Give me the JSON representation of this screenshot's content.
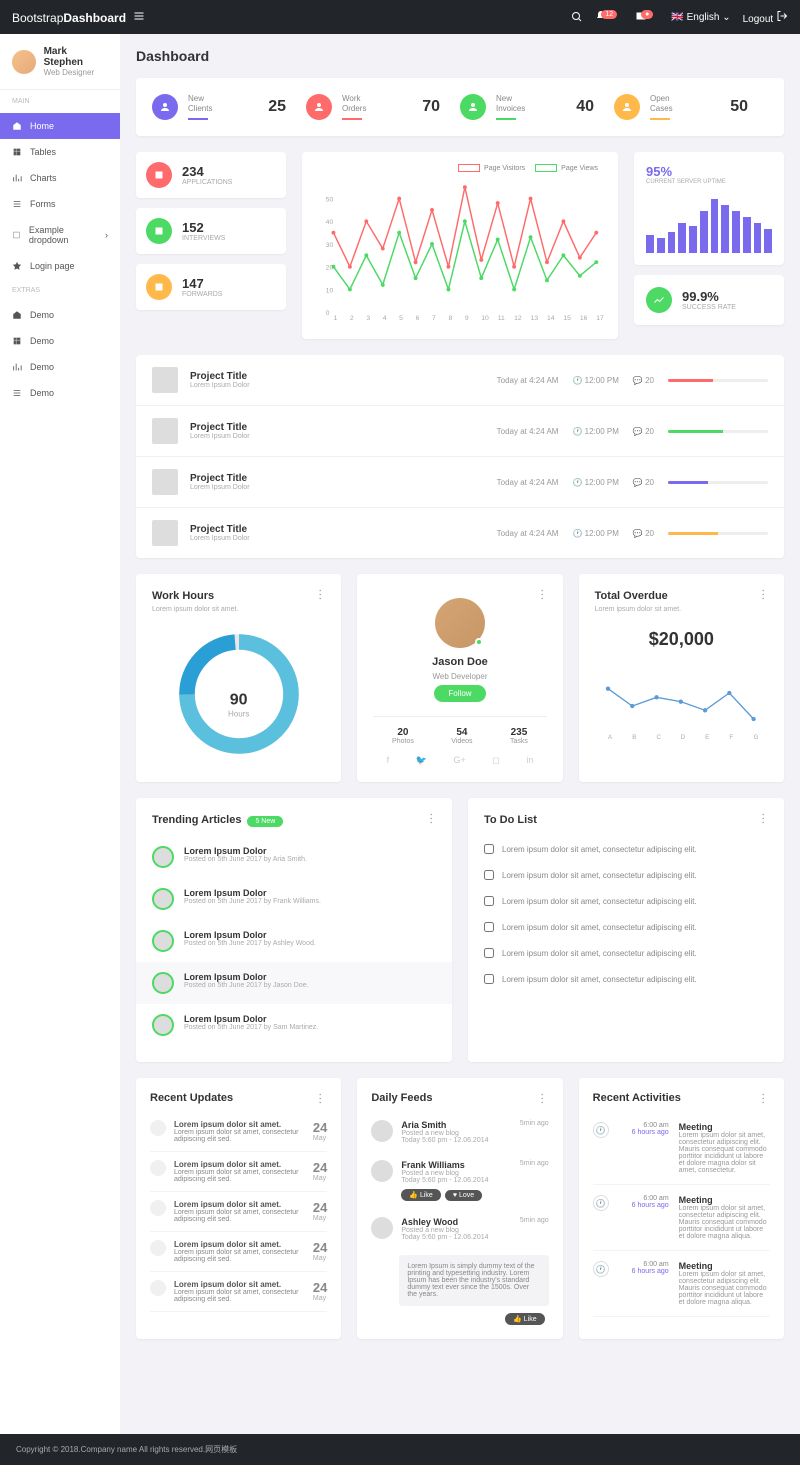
{
  "brand": {
    "a": "Bootstrap",
    "b": "Dashboard"
  },
  "topbar": {
    "lang": "English",
    "logout": "Logout",
    "notif_count": "12"
  },
  "user": {
    "name": "Mark Stephen",
    "role": "Web Designer"
  },
  "nav": {
    "sec1": "MAIN",
    "sec2": "EXTRAS",
    "items": [
      "Home",
      "Tables",
      "Charts",
      "Forms",
      "Example dropdown",
      "Login page"
    ],
    "extras": [
      "Demo",
      "Demo",
      "Demo",
      "Demo"
    ]
  },
  "page_title": "Dashboard",
  "stats": [
    {
      "label": "New Clients",
      "value": "25",
      "color": "#796aee"
    },
    {
      "label": "Work Orders",
      "value": "70",
      "color": "#ff6b6b"
    },
    {
      "label": "New Invoices",
      "value": "40",
      "color": "#4cd964"
    },
    {
      "label": "Open Cases",
      "value": "50",
      "color": "#ffb94a"
    }
  ],
  "minis": [
    {
      "value": "234",
      "label": "APPLICATIONS",
      "color": "#ff6b6b"
    },
    {
      "value": "152",
      "label": "INTERVIEWS",
      "color": "#4cd964"
    },
    {
      "value": "147",
      "label": "FORWARDS",
      "color": "#ffb94a"
    }
  ],
  "chart_data": {
    "type": "line",
    "x": [
      "1",
      "2",
      "3",
      "4",
      "5",
      "6",
      "7",
      "8",
      "9",
      "10",
      "11",
      "12",
      "13",
      "14",
      "15",
      "16",
      "17"
    ],
    "ylim": [
      0,
      60
    ],
    "yticks": [
      0,
      10,
      20,
      30,
      40,
      50
    ],
    "series": [
      {
        "name": "Page Visitors",
        "color": "#ff6b6b",
        "values": [
          35,
          20,
          40,
          28,
          50,
          22,
          45,
          20,
          55,
          23,
          48,
          20,
          50,
          22,
          40,
          24,
          35
        ]
      },
      {
        "name": "Page Views",
        "color": "#4cd964",
        "values": [
          20,
          10,
          25,
          12,
          35,
          15,
          30,
          10,
          40,
          15,
          32,
          10,
          33,
          14,
          25,
          16,
          22
        ]
      }
    ]
  },
  "uptime": {
    "value": "95%",
    "label": "CURRENT SERVER UPTIME",
    "bars": [
      30,
      25,
      35,
      50,
      45,
      70,
      90,
      80,
      70,
      60,
      50,
      40
    ]
  },
  "success": {
    "value": "99.9%",
    "label": "SUCCESS RATE"
  },
  "projects": [
    {
      "title": "Project Title",
      "sub": "Lorem Ipsum Dolor",
      "time": "Today at 4:24 AM",
      "clock": "12:00 PM",
      "comments": "20",
      "color": "#ff6b6b",
      "pct": 45
    },
    {
      "title": "Project Title",
      "sub": "Lorem Ipsum Dolor",
      "time": "Today at 4:24 AM",
      "clock": "12:00 PM",
      "comments": "20",
      "color": "#4cd964",
      "pct": 55
    },
    {
      "title": "Project Title",
      "sub": "Lorem Ipsum Dolor",
      "time": "Today at 4:24 AM",
      "clock": "12:00 PM",
      "comments": "20",
      "color": "#796aee",
      "pct": 40
    },
    {
      "title": "Project Title",
      "sub": "Lorem Ipsum Dolor",
      "time": "Today at 4:24 AM",
      "clock": "12:00 PM",
      "comments": "20",
      "color": "#ffb94a",
      "pct": 50
    }
  ],
  "workhours": {
    "title": "Work Hours",
    "sub": "Lorem ipsum dolor sit amet.",
    "value": "90",
    "unit": "Hours"
  },
  "usercard": {
    "name": "Jason Doe",
    "role": "Web Developer",
    "follow": "Follow",
    "stats": [
      {
        "v": "20",
        "l": "Photos"
      },
      {
        "v": "54",
        "l": "Videos"
      },
      {
        "v": "235",
        "l": "Tasks"
      }
    ]
  },
  "overdue": {
    "title": "Total Overdue",
    "sub": "Lorem ipsum dolor sit amet.",
    "value": "$20,000",
    "x": [
      "A",
      "B",
      "C",
      "D",
      "E",
      "F",
      "G"
    ],
    "y": [
      50,
      30,
      40,
      35,
      25,
      45,
      15
    ]
  },
  "trending": {
    "title": "Trending Articles",
    "badge": "5 New",
    "items": [
      {
        "title": "Lorem Ipsum Dolor",
        "sub": "Posted on 5th June 2017 by Aria Smith."
      },
      {
        "title": "Lorem Ipsum Dolor",
        "sub": "Posted on 5th June 2017 by Frank Williams."
      },
      {
        "title": "Lorem Ipsum Dolor",
        "sub": "Posted on 5th June 2017 by Ashley Wood."
      },
      {
        "title": "Lorem Ipsum Dolor",
        "sub": "Posted on 5th June 2017 by Jason Doe."
      },
      {
        "title": "Lorem Ipsum Dolor",
        "sub": "Posted on 5th June 2017 by Sam Martinez."
      }
    ]
  },
  "todo": {
    "title": "To Do List",
    "items": [
      "Lorem ipsum dolor sit amet, consectetur adipiscing elit.",
      "Lorem ipsum dolor sit amet, consectetur adipiscing elit.",
      "Lorem ipsum dolor sit amet, consectetur adipiscing elit.",
      "Lorem ipsum dolor sit amet, consectetur adipiscing elit.",
      "Lorem ipsum dolor sit amet, consectetur adipiscing elit.",
      "Lorem ipsum dolor sit amet, consectetur adipiscing elit."
    ]
  },
  "updates": {
    "title": "Recent Updates",
    "day": "24",
    "month": "May",
    "items": [
      "Lorem ipsum dolor sit amet.",
      "Lorem ipsum dolor sit amet, consectetur adipiscing elit sed.",
      "Lorem ipsum dolor sit amet.",
      "Lorem ipsum dolor sit amet, consectetur adipiscing elit sed.",
      "Lorem ipsum dolor sit amet.",
      "Lorem ipsum dolor sit amet, consectetur adipiscing elit sed.",
      "Lorem ipsum dolor sit amet.",
      "Lorem ipsum dolor sit amet, consectetur adipiscing elit sed.",
      "Lorem ipsum dolor sit amet.",
      "Lorem ipsum dolor sit amet, consectetur adipiscing elit sed."
    ]
  },
  "feeds": {
    "title": "Daily Feeds",
    "ago": "5min ago",
    "like": "Like",
    "love": "Love",
    "items": [
      {
        "name": "Aria Smith",
        "sub": "Posted a new blog",
        "time": "Today 5:60 pm - 12.06.2014"
      },
      {
        "name": "Frank Williams",
        "sub": "Posted a new blog",
        "time": "Today 5:60 pm - 12.06.2014"
      },
      {
        "name": "Ashley Wood",
        "sub": "Posted a new blog",
        "time": "Today 5:60 pm - 12.06.2014"
      }
    ],
    "quote": "Lorem Ipsum is simply dummy text of the printing and typesetting industry. Lorem Ipsum has been the industry's standard dummy text ever since the 1500s. Over the years."
  },
  "activities": {
    "title": "Recent Activities",
    "time": "6:00 am",
    "ago": "6 hours ago",
    "items": [
      {
        "title": "Meeting",
        "desc": "Lorem ipsum dolor sit amet, consectetur adipiscing elit. Mauris consequat commodo porttitor incididunt ut labore et dolore magna dolor sit amet, consectetur."
      },
      {
        "title": "Meeting",
        "desc": "Lorem ipsum dolor sit amet, consectetur adipiscing elit. Mauris consequat commodo porttitor incididunt ut labore et dolore magna aliqua."
      },
      {
        "title": "Meeting",
        "desc": "Lorem ipsum dolor sit amet, consectetur adipiscing elit. Mauris consequat commodo porttitor incididunt ut labore et dolore magna aliqua."
      }
    ]
  },
  "footer": "Copyright © 2018.Company name All rights reserved.网页模板"
}
